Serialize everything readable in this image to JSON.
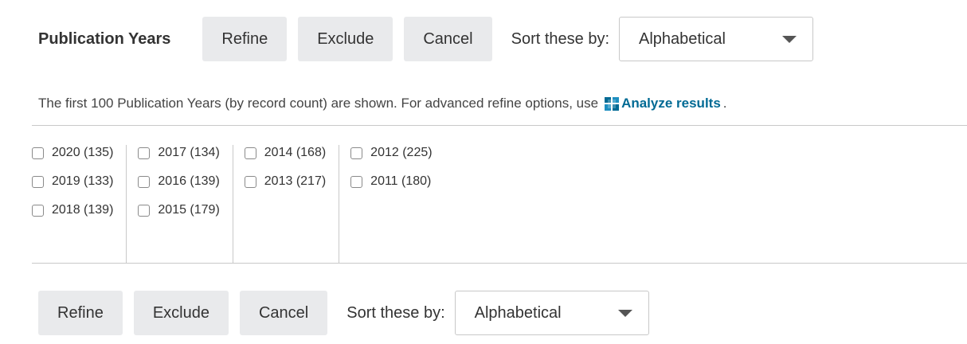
{
  "header": {
    "title": "Publication Years",
    "refine_label": "Refine",
    "exclude_label": "Exclude",
    "cancel_label": "Cancel",
    "sort_label": "Sort these by:",
    "sort_value": "Alphabetical"
  },
  "info": {
    "text": "The first 100 Publication Years (by record count) are shown. For advanced refine options, use",
    "link_label": "Analyze results",
    "link_icon": "analyze-chart-icon",
    "suffix": ".",
    "link_color": "#006a94"
  },
  "columns": [
    [
      {
        "label": "2020 (135)"
      },
      {
        "label": "2019 (133)"
      },
      {
        "label": "2018 (139)"
      }
    ],
    [
      {
        "label": "2017 (134)"
      },
      {
        "label": "2016 (139)"
      },
      {
        "label": "2015 (179)"
      }
    ],
    [
      {
        "label": "2014 (168)"
      },
      {
        "label": "2013 (217)"
      }
    ],
    [
      {
        "label": "2012 (225)"
      },
      {
        "label": "2011 (180)"
      }
    ]
  ],
  "footer": {
    "refine_label": "Refine",
    "exclude_label": "Exclude",
    "cancel_label": "Cancel",
    "sort_label": "Sort these by:",
    "sort_value": "Alphabetical"
  }
}
